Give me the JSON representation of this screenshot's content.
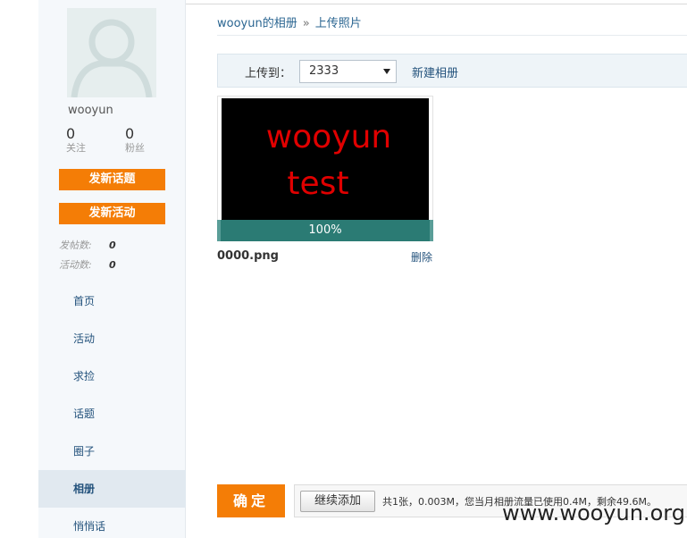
{
  "sidebar": {
    "username": "wooyun",
    "stats": [
      {
        "value": "0",
        "label": "关注"
      },
      {
        "value": "0",
        "label": "粉丝"
      }
    ],
    "new_topic_button": "发新话题",
    "new_event_button": "发新活动",
    "post_count_label": "发帖数:",
    "post_count_value": "0",
    "event_count_label": "活动数:",
    "event_count_value": "0",
    "nav": [
      {
        "label": "首页"
      },
      {
        "label": "活动"
      },
      {
        "label": "求捡"
      },
      {
        "label": "话题"
      },
      {
        "label": "圈子"
      },
      {
        "label": "相册",
        "active": true
      },
      {
        "label": "悄悄话"
      }
    ]
  },
  "breadcrumb": {
    "album_link": "wooyun的相册",
    "separator": "»",
    "current": "上传照片"
  },
  "upload_bar": {
    "label": "上传到：",
    "selected_album": "2333",
    "new_album_link": "新建相册"
  },
  "photo": {
    "image_text_line1": "wooyun",
    "image_text_line2": "test",
    "progress_percent": 100,
    "progress_label": "100%",
    "filename": "0000.png",
    "delete_link": "删除"
  },
  "footer": {
    "confirm_button": "确定",
    "continue_button": "继续添加",
    "usage_text": "共1张，0.003M，您当月相册流量已使用0.4M，剩余49.6M。"
  },
  "watermark": "www.wooyun.org",
  "colors": {
    "accent_orange": "#f47d06",
    "link_blue": "#23527c",
    "progress_teal": "#2b7b74",
    "image_text_red": "#e00000"
  }
}
